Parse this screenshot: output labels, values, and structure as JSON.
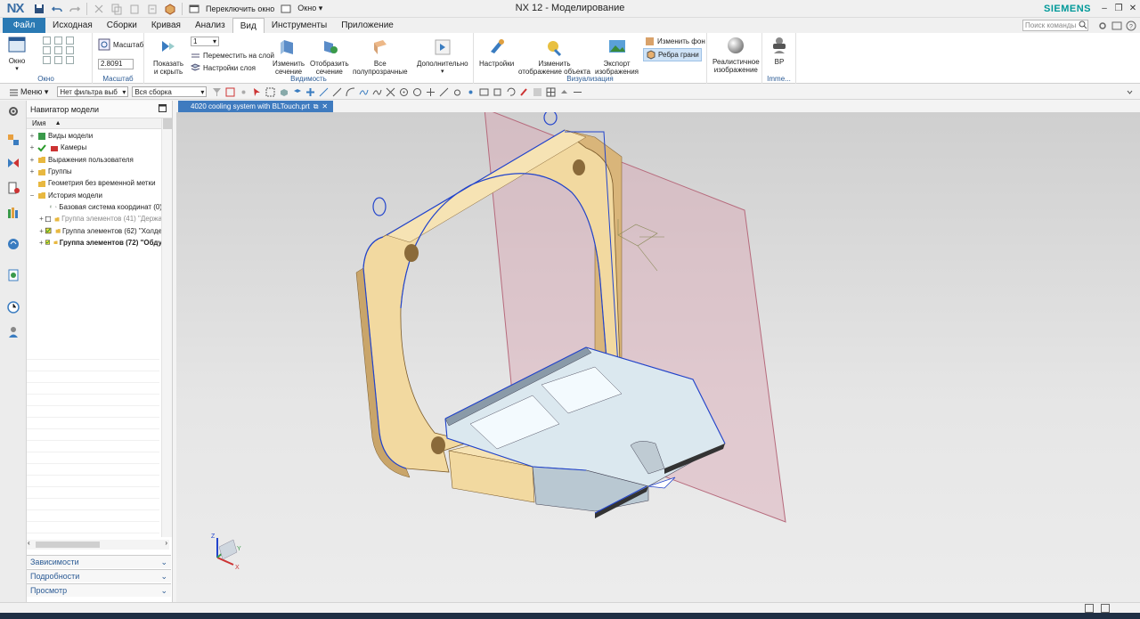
{
  "app": {
    "logo": "NX",
    "title": "NX 12 - Моделирование",
    "brand": "SIEMENS"
  },
  "quick_access": {
    "switch_window": "Переключить окно",
    "window_menu": "Окно ▾"
  },
  "tabs": [
    {
      "label": "Файл"
    },
    {
      "label": "Исходная"
    },
    {
      "label": "Сборки"
    },
    {
      "label": "Кривая"
    },
    {
      "label": "Анализ"
    },
    {
      "label": "Вид"
    },
    {
      "label": "Инструменты"
    },
    {
      "label": "Приложение"
    }
  ],
  "search": {
    "placeholder": "Поиск команды"
  },
  "ribbon": {
    "window_group": {
      "label": "Окно",
      "button": "Окно"
    },
    "scale_group": {
      "label": "Масштаб",
      "button": "Масштаб",
      "value": "2.8091"
    },
    "visibility_group": {
      "label": "Видимость",
      "layer_value": "1",
      "show_hide": [
        "Показать",
        "и скрыть"
      ],
      "move_to_layer": "Переместить на слой",
      "layer_settings": "Настройки слоя",
      "edit_section": [
        "Изменить",
        "сечение"
      ],
      "show_section": [
        "Отобразить",
        "сечение"
      ],
      "all_transparent": [
        "Все",
        "полупрозрачные"
      ],
      "more": "Дополнительно"
    },
    "visualization_group": {
      "label": "Визуализация",
      "settings": "Настройки",
      "edit_display": [
        "Изменить",
        "отображение объекта"
      ],
      "export_image": [
        "Экспорт",
        "изображения"
      ],
      "change_background": "Изменить фон",
      "face_edges": "Ребра грани"
    },
    "realistic": [
      "Реалистичное",
      "изображение"
    ],
    "vr": {
      "button": "ВР",
      "group_label": "Imme..."
    }
  },
  "toolbar": {
    "menu": "Меню ▾",
    "filter": "Нет фильтра выб",
    "assembly": "Вся сборка"
  },
  "navigator": {
    "title": "Навигатор модели",
    "column": "Имя",
    "items": [
      {
        "exp": "+",
        "label": "Виды модели"
      },
      {
        "exp": "+",
        "label": "Камеры"
      },
      {
        "exp": "+",
        "label": "Выражения пользователя"
      },
      {
        "exp": "+",
        "label": "Группы"
      },
      {
        "exp": "",
        "label": "Геометрия без временной метки"
      },
      {
        "exp": "−",
        "label": "История модели"
      },
      {
        "exp": "",
        "label": "Базовая система координат (0)"
      },
      {
        "exp": "+",
        "label": "Группа элементов (41) \"Держа"
      },
      {
        "exp": "+",
        "label": "Группа элементов (62) \"Холде"
      },
      {
        "exp": "+",
        "label": "Группа элементов (72) \"Обду"
      }
    ],
    "panels": [
      "Зависимости",
      "Подробности",
      "Просмотр"
    ]
  },
  "document": {
    "tab_label": "4020 cooling system with BLTouch.prt"
  },
  "triad": {
    "x": "X",
    "y": "Y",
    "z": "Z"
  },
  "colors": {
    "accent": "#2a7ab4",
    "doc_tab": "#3f7bbf",
    "part_yellow": "#f2d9a0",
    "part_blue": "#d8e7ee",
    "datum_plane": "#d9a7b4"
  }
}
